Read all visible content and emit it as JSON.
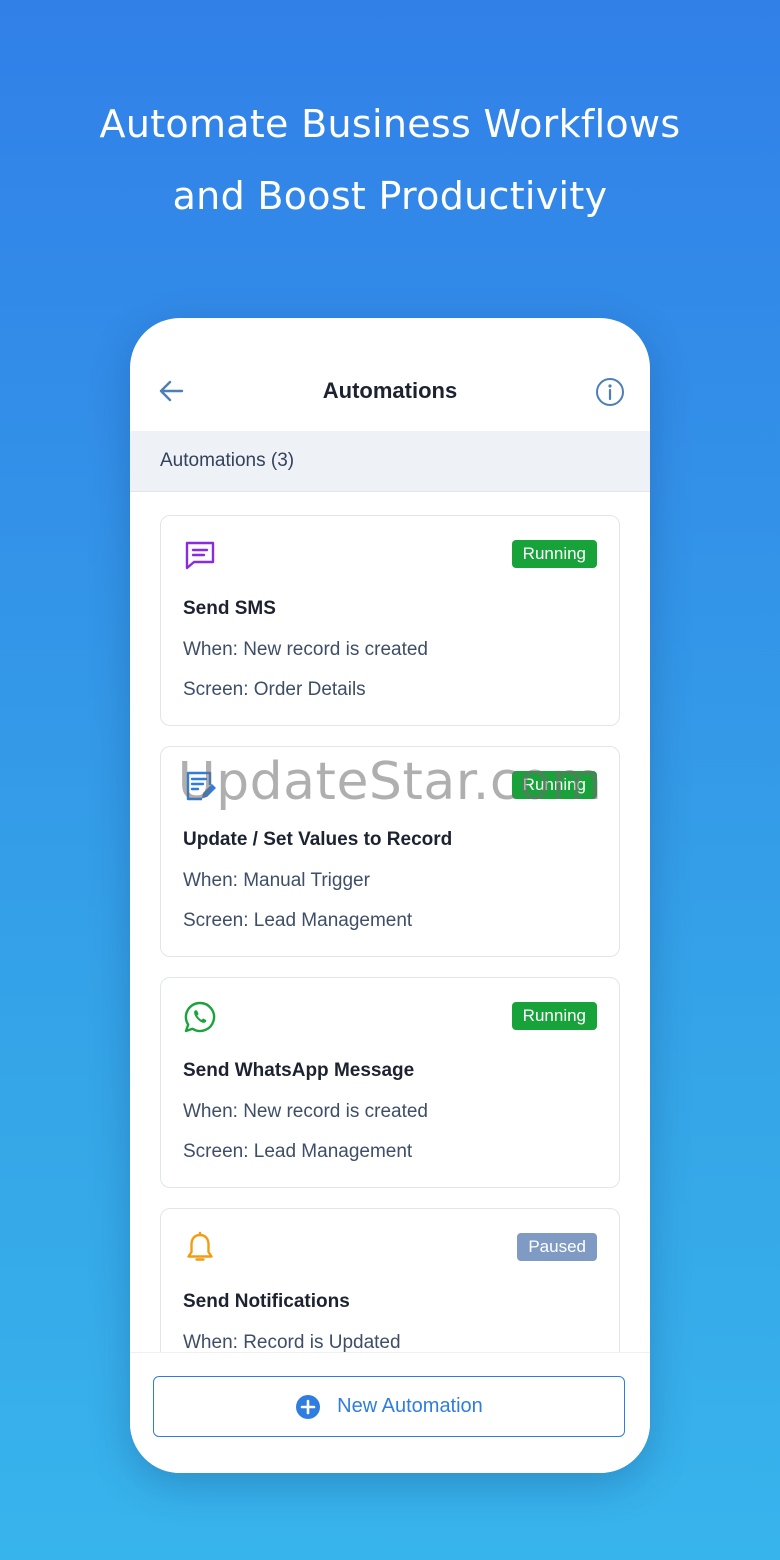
{
  "headline": {
    "line1": "Automate Business Workflows",
    "line2": "and Boost Productivity"
  },
  "appbar": {
    "title": "Automations",
    "back_icon": "arrow-left-icon",
    "info_icon": "info-icon"
  },
  "section": {
    "header": "Automations (3)"
  },
  "colors": {
    "running": "#18a33a",
    "paused": "#7f9bc4",
    "accent": "#2f7de1"
  },
  "automations": [
    {
      "icon": "message-icon",
      "status": "Running",
      "title": "Send SMS",
      "when": "When: New record is created",
      "screen": "Screen: Order Details"
    },
    {
      "icon": "edit-record-icon",
      "status": "Running",
      "title": "Update / Set Values to Record",
      "when": "When: Manual Trigger",
      "screen": "Screen: Lead Management"
    },
    {
      "icon": "whatsapp-icon",
      "status": "Running",
      "title": "Send WhatsApp Message",
      "when": "When: New record is created",
      "screen": "Screen: Lead Management"
    },
    {
      "icon": "bell-icon",
      "status": "Paused",
      "title": "Send Notifications",
      "when": "When: Record is Updated",
      "screen": ""
    }
  ],
  "footer": {
    "new_button_label": "New Automation",
    "new_button_icon": "plus-circle-icon"
  },
  "watermark": "UpdateStar.com"
}
